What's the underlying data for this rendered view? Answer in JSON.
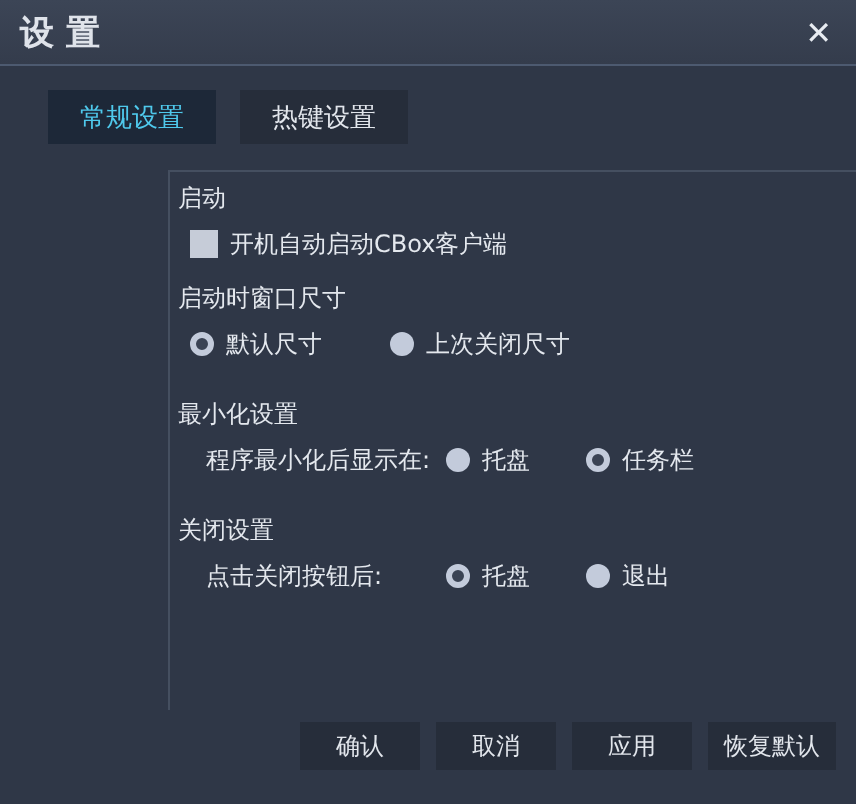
{
  "window": {
    "title": "设 置",
    "close": "✕"
  },
  "tabs": [
    {
      "label": "常规设置",
      "selected": true
    },
    {
      "label": "热键设置",
      "selected": false
    }
  ],
  "sections": [
    {
      "title": "启动",
      "kind": "checkbox",
      "options": [
        {
          "label": "开机自动启动CBox客户端",
          "checked": false
        }
      ]
    },
    {
      "title": "启动时窗口尺寸",
      "kind": "radio",
      "options": [
        {
          "label": "默认尺寸",
          "selected": true
        },
        {
          "label": "上次关闭尺寸",
          "selected": false
        }
      ]
    },
    {
      "title": "最小化设置",
      "kind": "radio",
      "prompt": "程序最小化后显示在:",
      "options": [
        {
          "label": "托盘",
          "selected": false
        },
        {
          "label": "任务栏",
          "selected": true
        }
      ]
    },
    {
      "title": "关闭设置",
      "kind": "radio",
      "prompt": "点击关闭按钮后:",
      "options": [
        {
          "label": "托盘",
          "selected": true
        },
        {
          "label": "退出",
          "selected": false
        }
      ]
    }
  ],
  "buttons": [
    "确认",
    "取消",
    "应用",
    "恢复默认"
  ]
}
